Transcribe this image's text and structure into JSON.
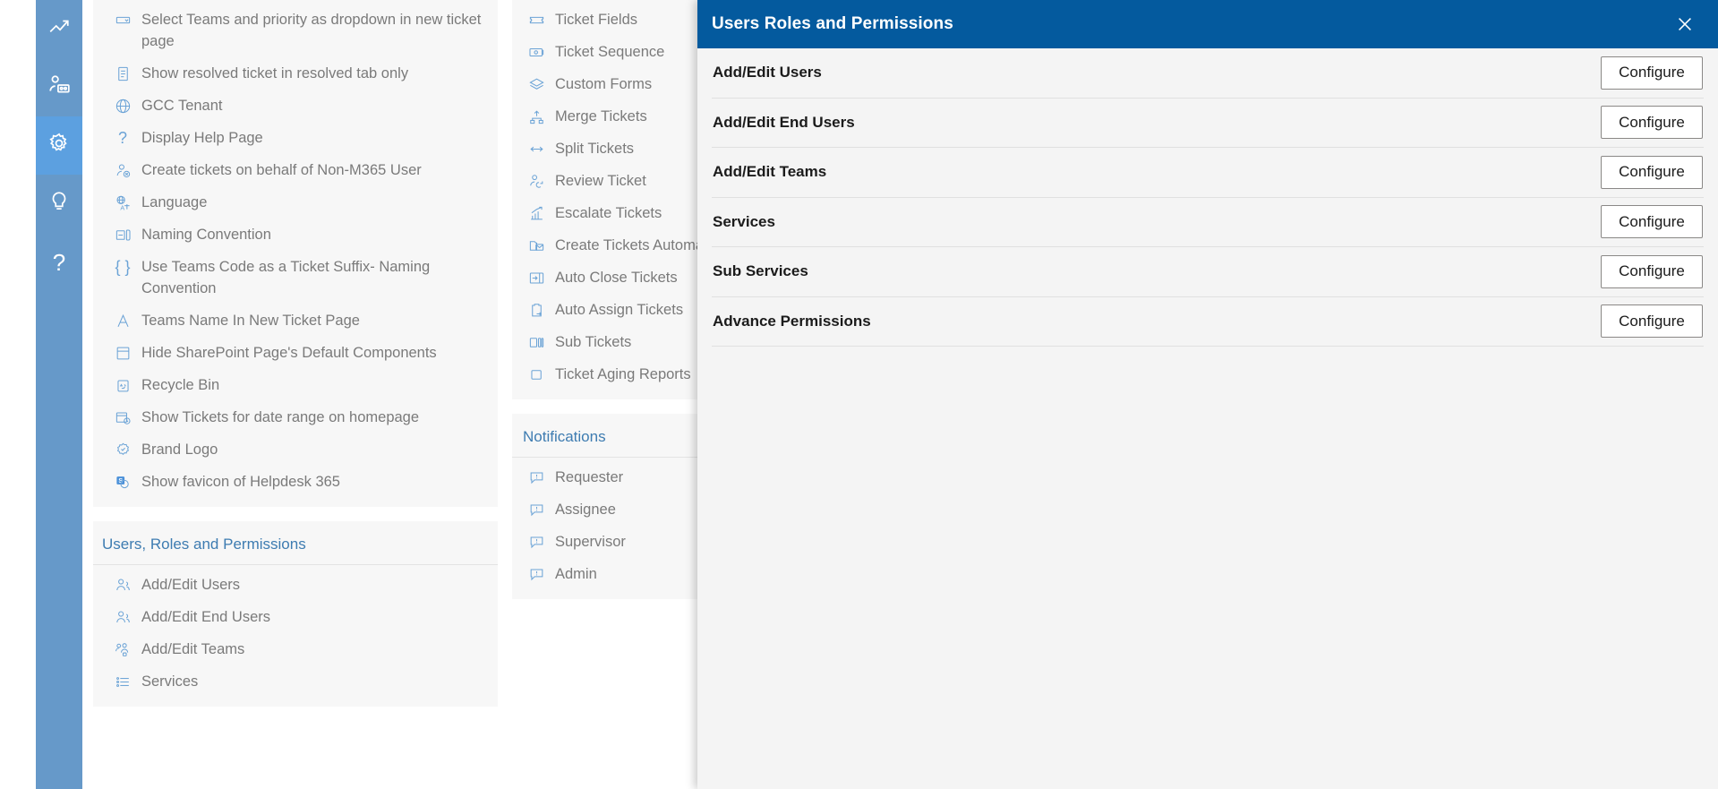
{
  "rail": {
    "items": [
      {
        "name": "analytics-icon",
        "label": "Analytics"
      },
      {
        "name": "agents-icon",
        "label": "Agents"
      },
      {
        "name": "settings-icon",
        "label": "Settings",
        "active": true
      },
      {
        "name": "ideas-icon",
        "label": "Ideas"
      },
      {
        "name": "help-icon",
        "label": "Help"
      }
    ],
    "accent": "#6699c9",
    "active_accent": "#5ca0e0"
  },
  "column1": {
    "general_settings": {
      "items": [
        {
          "icon": "dropdown-icon",
          "label": "Select Teams and priority as dropdown in new ticket page"
        },
        {
          "icon": "document-icon",
          "label": "Show resolved ticket in resolved tab only"
        },
        {
          "icon": "globe-icon",
          "label": "GCC Tenant"
        },
        {
          "icon": "question-icon",
          "label": "Display Help Page"
        },
        {
          "icon": "user-block-icon",
          "label": "Create tickets on behalf of Non-M365 User"
        },
        {
          "icon": "language-icon",
          "label": "Language"
        },
        {
          "icon": "naming-icon",
          "label": "Naming Convention"
        },
        {
          "icon": "braces-icon",
          "label": "Use Teams Code as a Ticket Suffix- Naming Convention"
        },
        {
          "icon": "font-icon",
          "label": "Teams Name In New Ticket Page"
        },
        {
          "icon": "page-icon",
          "label": "Hide SharePoint Page's Default Components"
        },
        {
          "icon": "recycle-bin-icon",
          "label": "Recycle Bin"
        },
        {
          "icon": "date-range-icon",
          "label": "Show Tickets for date range on homepage"
        },
        {
          "icon": "badge-icon",
          "label": "Brand Logo"
        },
        {
          "icon": "favicon-icon",
          "label": "Show favicon of Helpdesk 365"
        }
      ]
    },
    "users_roles": {
      "title": "Users, Roles and Permissions",
      "items": [
        {
          "icon": "users-icon",
          "label": "Add/Edit Users"
        },
        {
          "icon": "users-icon",
          "label": "Add/Edit End Users"
        },
        {
          "icon": "teams-icon",
          "label": "Add/Edit Teams"
        },
        {
          "icon": "services-icon",
          "label": "Services"
        }
      ]
    }
  },
  "column2": {
    "tickets": {
      "items": [
        {
          "icon": "ticket-icon",
          "label": "Ticket Fields"
        },
        {
          "icon": "sequence-icon",
          "label": "Ticket Sequence"
        },
        {
          "icon": "layers-icon",
          "label": "Custom Forms"
        },
        {
          "icon": "merge-icon",
          "label": "Merge Tickets"
        },
        {
          "icon": "split-icon",
          "label": "Split Tickets"
        },
        {
          "icon": "review-icon",
          "label": "Review Ticket"
        },
        {
          "icon": "escalate-icon",
          "label": "Escalate Tickets"
        },
        {
          "icon": "mail-folder-icon",
          "label": "Create Tickets Automatically"
        },
        {
          "icon": "auto-close-icon",
          "label": "Auto Close Tickets"
        },
        {
          "icon": "clipboard-icon",
          "label": "Auto Assign Tickets"
        },
        {
          "icon": "sub-tickets-icon",
          "label": "Sub Tickets"
        },
        {
          "icon": "square-icon",
          "label": "Ticket Aging Reports"
        }
      ]
    },
    "notifications": {
      "title": "Notifications",
      "items": [
        {
          "icon": "comment-alert-icon",
          "label": "Requester"
        },
        {
          "icon": "comment-alert-icon",
          "label": "Assignee"
        },
        {
          "icon": "comment-alert-icon",
          "label": "Supervisor"
        },
        {
          "icon": "comment-alert-icon",
          "label": "Admin"
        }
      ]
    }
  },
  "modal": {
    "title": "Users Roles and Permissions",
    "close_icon": "close-icon",
    "header_color": "#045a9e",
    "rows": [
      {
        "label": "Add/Edit Users",
        "button": "Configure"
      },
      {
        "label": "Add/Edit End Users",
        "button": "Configure"
      },
      {
        "label": "Add/Edit Teams",
        "button": "Configure"
      },
      {
        "label": "Services",
        "button": "Configure"
      },
      {
        "label": "Sub Services",
        "button": "Configure"
      },
      {
        "label": "Advance Permissions",
        "button": "Configure"
      }
    ]
  }
}
